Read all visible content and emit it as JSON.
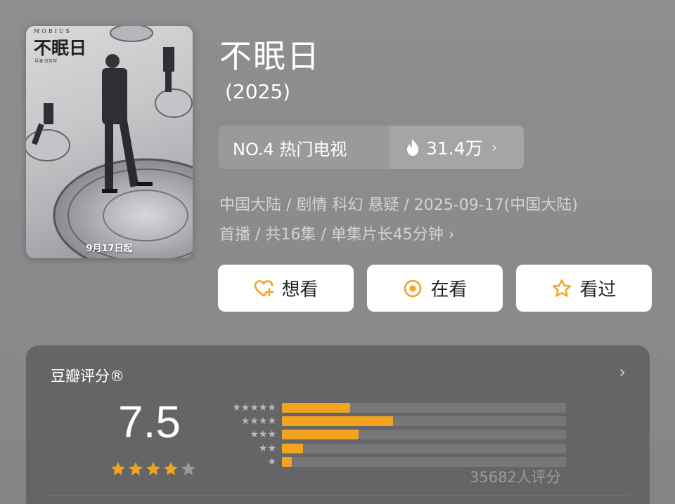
{
  "poster": {
    "brand": "MOBIUS",
    "title_art": "不眠日",
    "credits": "导演 白百何",
    "date_badge": "9月17日起"
  },
  "title": "不眠日",
  "year": "(2025)",
  "ranking": {
    "label": "NO.4 热门电视",
    "heat": "31.4万",
    "heat_icon": "flame-icon",
    "chevron": "›"
  },
  "meta": {
    "line1": "中国大陆 / 剧情 科幻 悬疑 / 2025-09-17(中国大陆)",
    "line2": "首播 / 共16集 / 单集片长45分钟",
    "chevron": "›"
  },
  "actions": [
    {
      "label": "想看",
      "icon": "heart-plus-icon"
    },
    {
      "label": "在看",
      "icon": "watching-circle-icon"
    },
    {
      "label": "看过",
      "icon": "star-outline-icon"
    }
  ],
  "rating": {
    "title": "豆瓣评分®",
    "chevron": "›",
    "score": "7.5",
    "stars_filled": 4,
    "stars_total": 5,
    "distribution": [
      {
        "stars": 5,
        "fraction": 0.24
      },
      {
        "stars": 4,
        "fraction": 0.39
      },
      {
        "stars": 3,
        "fraction": 0.27
      },
      {
        "stars": 2,
        "fraction": 0.075
      },
      {
        "stars": 1,
        "fraction": 0.035
      }
    ],
    "count_text": "35682人评分"
  },
  "colors": {
    "accent": "#f2a320",
    "background": "#8c8c8e",
    "card": "#5f5f61"
  }
}
